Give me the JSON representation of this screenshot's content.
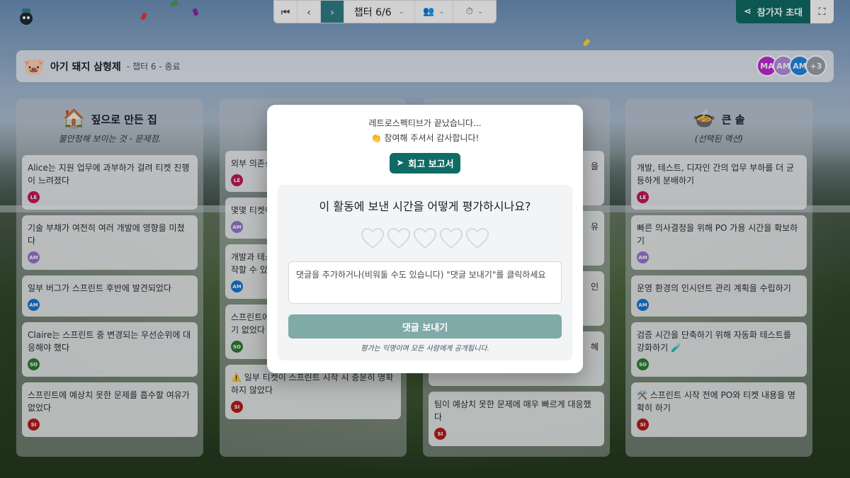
{
  "toolbar": {
    "chapter_label": "챕터 6/6",
    "invite_label": "참가자 초대"
  },
  "header": {
    "title": "아기 돼지 삼형제",
    "subtitle": "- 챕터 6 - 종료",
    "avatars": [
      "MA",
      "AM",
      "AM"
    ],
    "more_count": "+3"
  },
  "columns": [
    {
      "icon": "🏠",
      "title": "짚으로 만든 집",
      "description": "불안정해 보이는 것 - 문제점.",
      "cards": [
        {
          "text": "Alice는 지원 업무에 과부하가 걸려 티켓 진행이 느려졌다",
          "author": "LÉ",
          "color": "#c2185b"
        },
        {
          "text": "기술 부채가 여전히 여러 개발에 영향을 미쳤다",
          "author": "AM",
          "color": "#9575cd"
        },
        {
          "text": "일부 버그가 스프린트 후반에 발견되었다",
          "author": "AM",
          "color": "#1976d2"
        },
        {
          "text": "Claire는 스프린트 중 변경되는 우선순위에 대응해야 했다",
          "author": "SO",
          "color": "#2e7d32"
        },
        {
          "text": "스프린트에 예상치 못한 문제를 흡수할 여유가 없었다",
          "author": "SI",
          "color": "#b71c1c"
        }
      ]
    },
    {
      "icon": "",
      "title": "",
      "description": "",
      "cards": [
        {
          "text": "외부 의존성",
          "author": "LÉ",
          "color": "#c2185b"
        },
        {
          "text": "몇몇 티켓이",
          "author": "AM",
          "color": "#9575cd"
        },
        {
          "text": "개발과 테스트\n작할 수 있었",
          "author": "AM",
          "color": "#1976d2"
        },
        {
          "text": "스프린트에\n기 없었다",
          "author": "SO",
          "color": "#2e7d32"
        },
        {
          "text": "⚠️ 일부 티켓이 스프린트 시작 시 충분히 명확하지 않았다",
          "author": "SI",
          "color": "#b71c1c"
        }
      ]
    },
    {
      "icon": "",
      "title": "",
      "description": "",
      "cards": [
        {
          "text": "을",
          "author": "",
          "color": "#c2185b"
        },
        {
          "text": "유",
          "author": "",
          "color": "#9575cd"
        },
        {
          "text": "인",
          "author": "",
          "color": "#1976d2"
        },
        {
          "text": "혜",
          "author": "",
          "color": "#2e7d32"
        },
        {
          "text": "팀이 예상치 못한 문제에 매우 빠르게 대응했다",
          "author": "SI",
          "color": "#b71c1c"
        }
      ]
    },
    {
      "icon": "🍲",
      "title": "큰 솥",
      "description": "(선택된 액션)",
      "cards": [
        {
          "text": "개발, 테스트, 디자인 간의 업무 부하를 더 균등하게 분배하기",
          "author": "LÉ",
          "color": "#c2185b"
        },
        {
          "text": "빠른 의사결정을 위해 PO 가용 시간을 확보하기",
          "author": "AM",
          "color": "#9575cd"
        },
        {
          "text": "운영 환경의 인시던트 관리 계획을 수립하기",
          "author": "AM",
          "color": "#1976d2"
        },
        {
          "text": "검증 시간을 단축하기 위해 자동화 테스트를 강화하기 🧪",
          "author": "SO",
          "color": "#2e7d32"
        },
        {
          "text": "🛠️ 스프린트 시작 전에 PO와 티켓 내용을 명확히 하기",
          "author": "SI",
          "color": "#b71c1c"
        }
      ]
    }
  ],
  "modal": {
    "line1": "레트로스펙티브가 끝났습니다...",
    "line2": "👏 참여해 주셔서 감사합니다!",
    "report_label": "회고 보고서",
    "question": "이 활동에 보낸 시간을 어떻게 평가하시나요?",
    "rating": 0,
    "comment_placeholder": "댓글을 추가하거나(비워둘 수도 있습니다) \"댓글 보내기\"를 클릭하세요",
    "send_label": "댓글 보내기",
    "anon_note": "평가는 익명이며 모든 사람에게 공개됩니다."
  },
  "colors": {
    "accent": "#0f6b65",
    "toolbar_active": "#2e7e86",
    "send_disabled": "#7faaa7"
  }
}
